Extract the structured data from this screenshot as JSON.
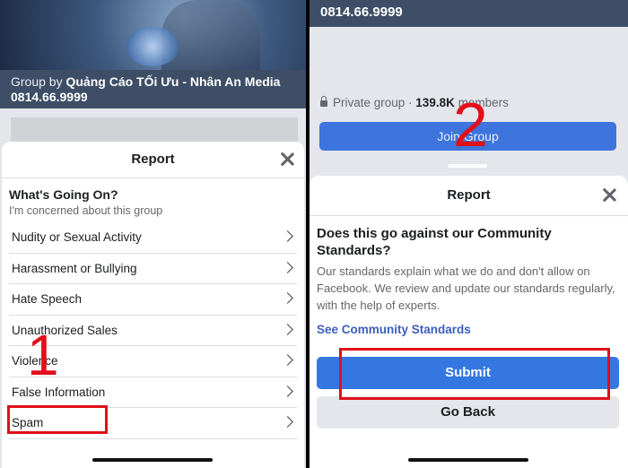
{
  "left": {
    "group_by_prefix": "Group by",
    "group_by_name": "Quảng Cáo TỐi Ưu - Nhân An Media",
    "group_phone": "0814.66.9999",
    "sheet_title": "Report",
    "question_title": "What's Going On?",
    "question_subtitle": "I'm concerned about this group",
    "options": [
      {
        "label": "Nudity or Sexual Activity"
      },
      {
        "label": "Harassment or Bullying"
      },
      {
        "label": "Hate Speech"
      },
      {
        "label": "Unauthorized Sales"
      },
      {
        "label": "Violence"
      },
      {
        "label": "False Information"
      },
      {
        "label": "Spam"
      }
    ],
    "step_number": "1",
    "close_icon": "close-icon",
    "chevron_icon": "chevron-right-icon"
  },
  "right": {
    "group_phone": "0814.66.9999",
    "privacy_text": "Private group · ",
    "members_count": "139.8K",
    "members_label": " members",
    "join_button": "Join Group",
    "sheet_title": "Report",
    "question": "Does this go against our Community Standards?",
    "description": "Our standards explain what we do and don't allow on Facebook. We review and update our standards regularly, with the help of experts.",
    "link_text": "See Community Standards",
    "submit_button": "Submit",
    "goback_button": "Go Back",
    "step_number": "2",
    "lock_icon": "lock-icon"
  },
  "colors": {
    "primary_button": "#3577e0",
    "annotation_red": "#e0101a",
    "link": "#3b5fbf"
  }
}
